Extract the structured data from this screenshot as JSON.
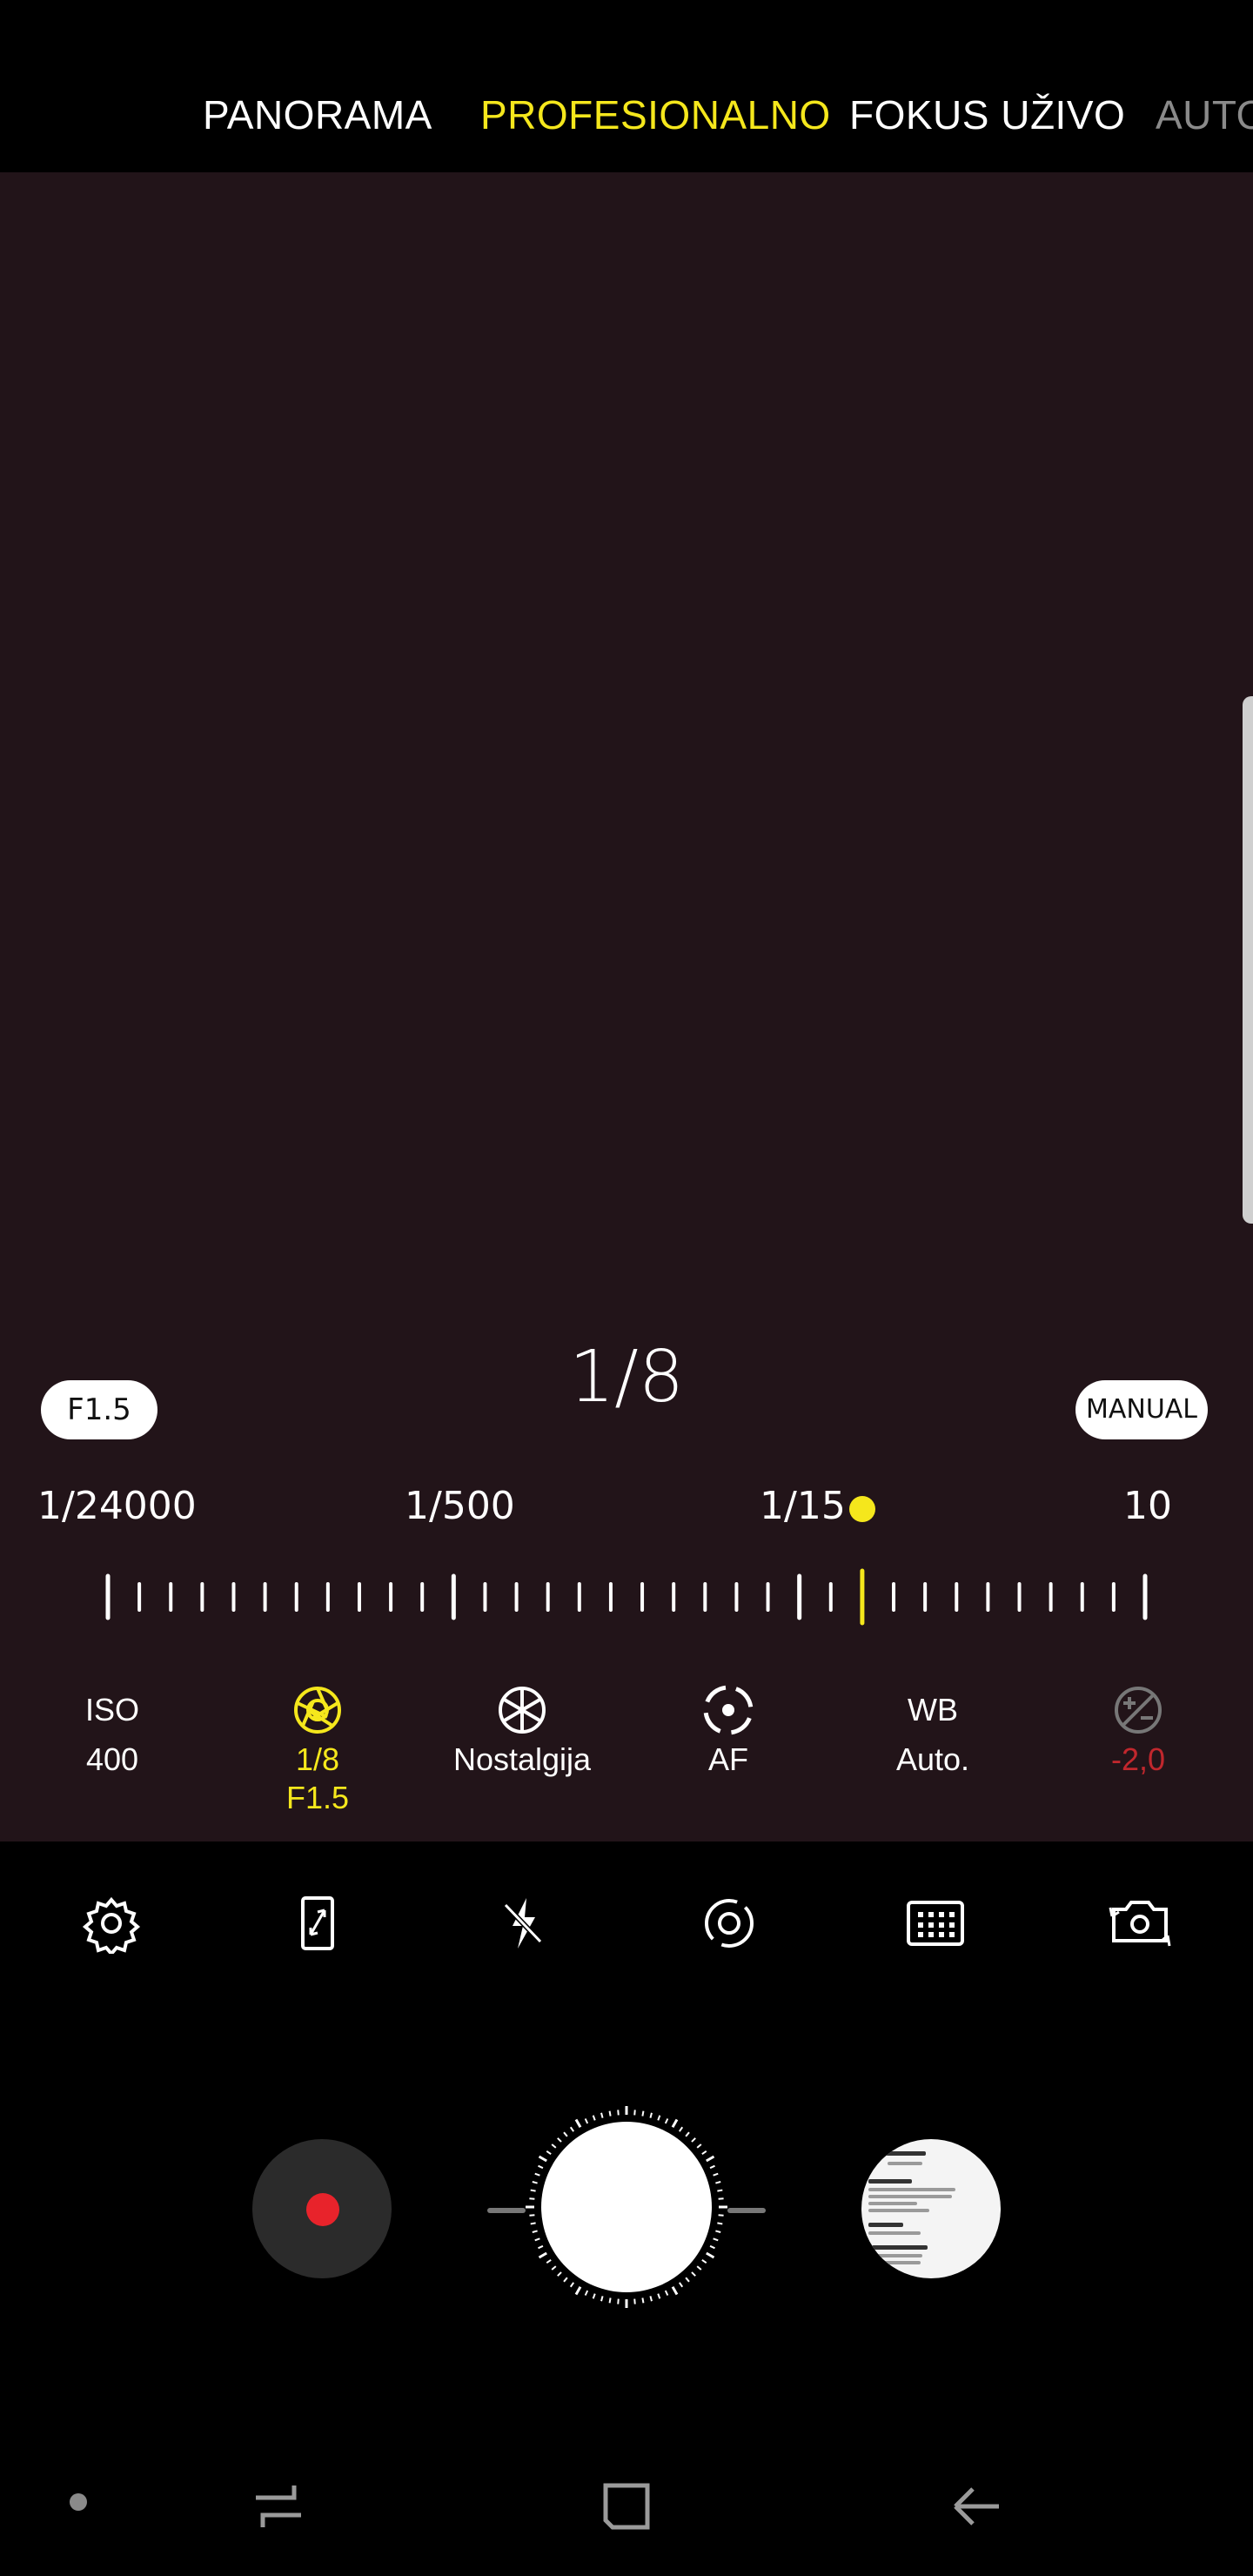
{
  "modes": {
    "items": [
      {
        "label": "PANORAMA",
        "state": "normal"
      },
      {
        "label": "PROFESIONALNO",
        "state": "active"
      },
      {
        "label": "FOKUS UŽIVO",
        "state": "normal"
      },
      {
        "label": "AUTO",
        "state": "faded"
      }
    ]
  },
  "viewfinder": {
    "shutter_value": "1/8",
    "aperture_pill": "F1.5",
    "mode_pill": "MANUAL"
  },
  "shutter_scale": {
    "labels": [
      "1/24000",
      "1/500",
      "1/15",
      "10"
    ],
    "current_marker": "1/8"
  },
  "settings": {
    "iso": {
      "label": "ISO",
      "value": "400"
    },
    "shutter": {
      "icon": "aperture-icon",
      "value": "1/8",
      "value2": "F1.5",
      "color": "#f5e71c"
    },
    "filter": {
      "icon": "filter-icon",
      "value": "Nostalgija"
    },
    "focus": {
      "icon": "focus-icon",
      "value": "AF"
    },
    "wb": {
      "label": "WB",
      "value": "Auto."
    },
    "exposure": {
      "icon": "exposure-icon",
      "value": "-2,0",
      "color": "#c1272d"
    }
  },
  "toolbar": {
    "icons": [
      "gear-icon",
      "aspect-ratio-icon",
      "flash-off-icon",
      "metering-icon",
      "grid-icon",
      "switch-camera-icon"
    ]
  },
  "capture": {
    "record_icon": "record-icon",
    "shutter_icon": "shutter-button",
    "gallery_icon": "gallery-thumbnail"
  },
  "navbar": {
    "icons": [
      "dot-indicator-icon",
      "recents-icon",
      "home-icon",
      "back-icon"
    ]
  },
  "colors": {
    "accent": "#f5e71c",
    "viewfinder_bg": "#221419",
    "record": "#e8232b",
    "exposure_negative": "#c1272d"
  }
}
